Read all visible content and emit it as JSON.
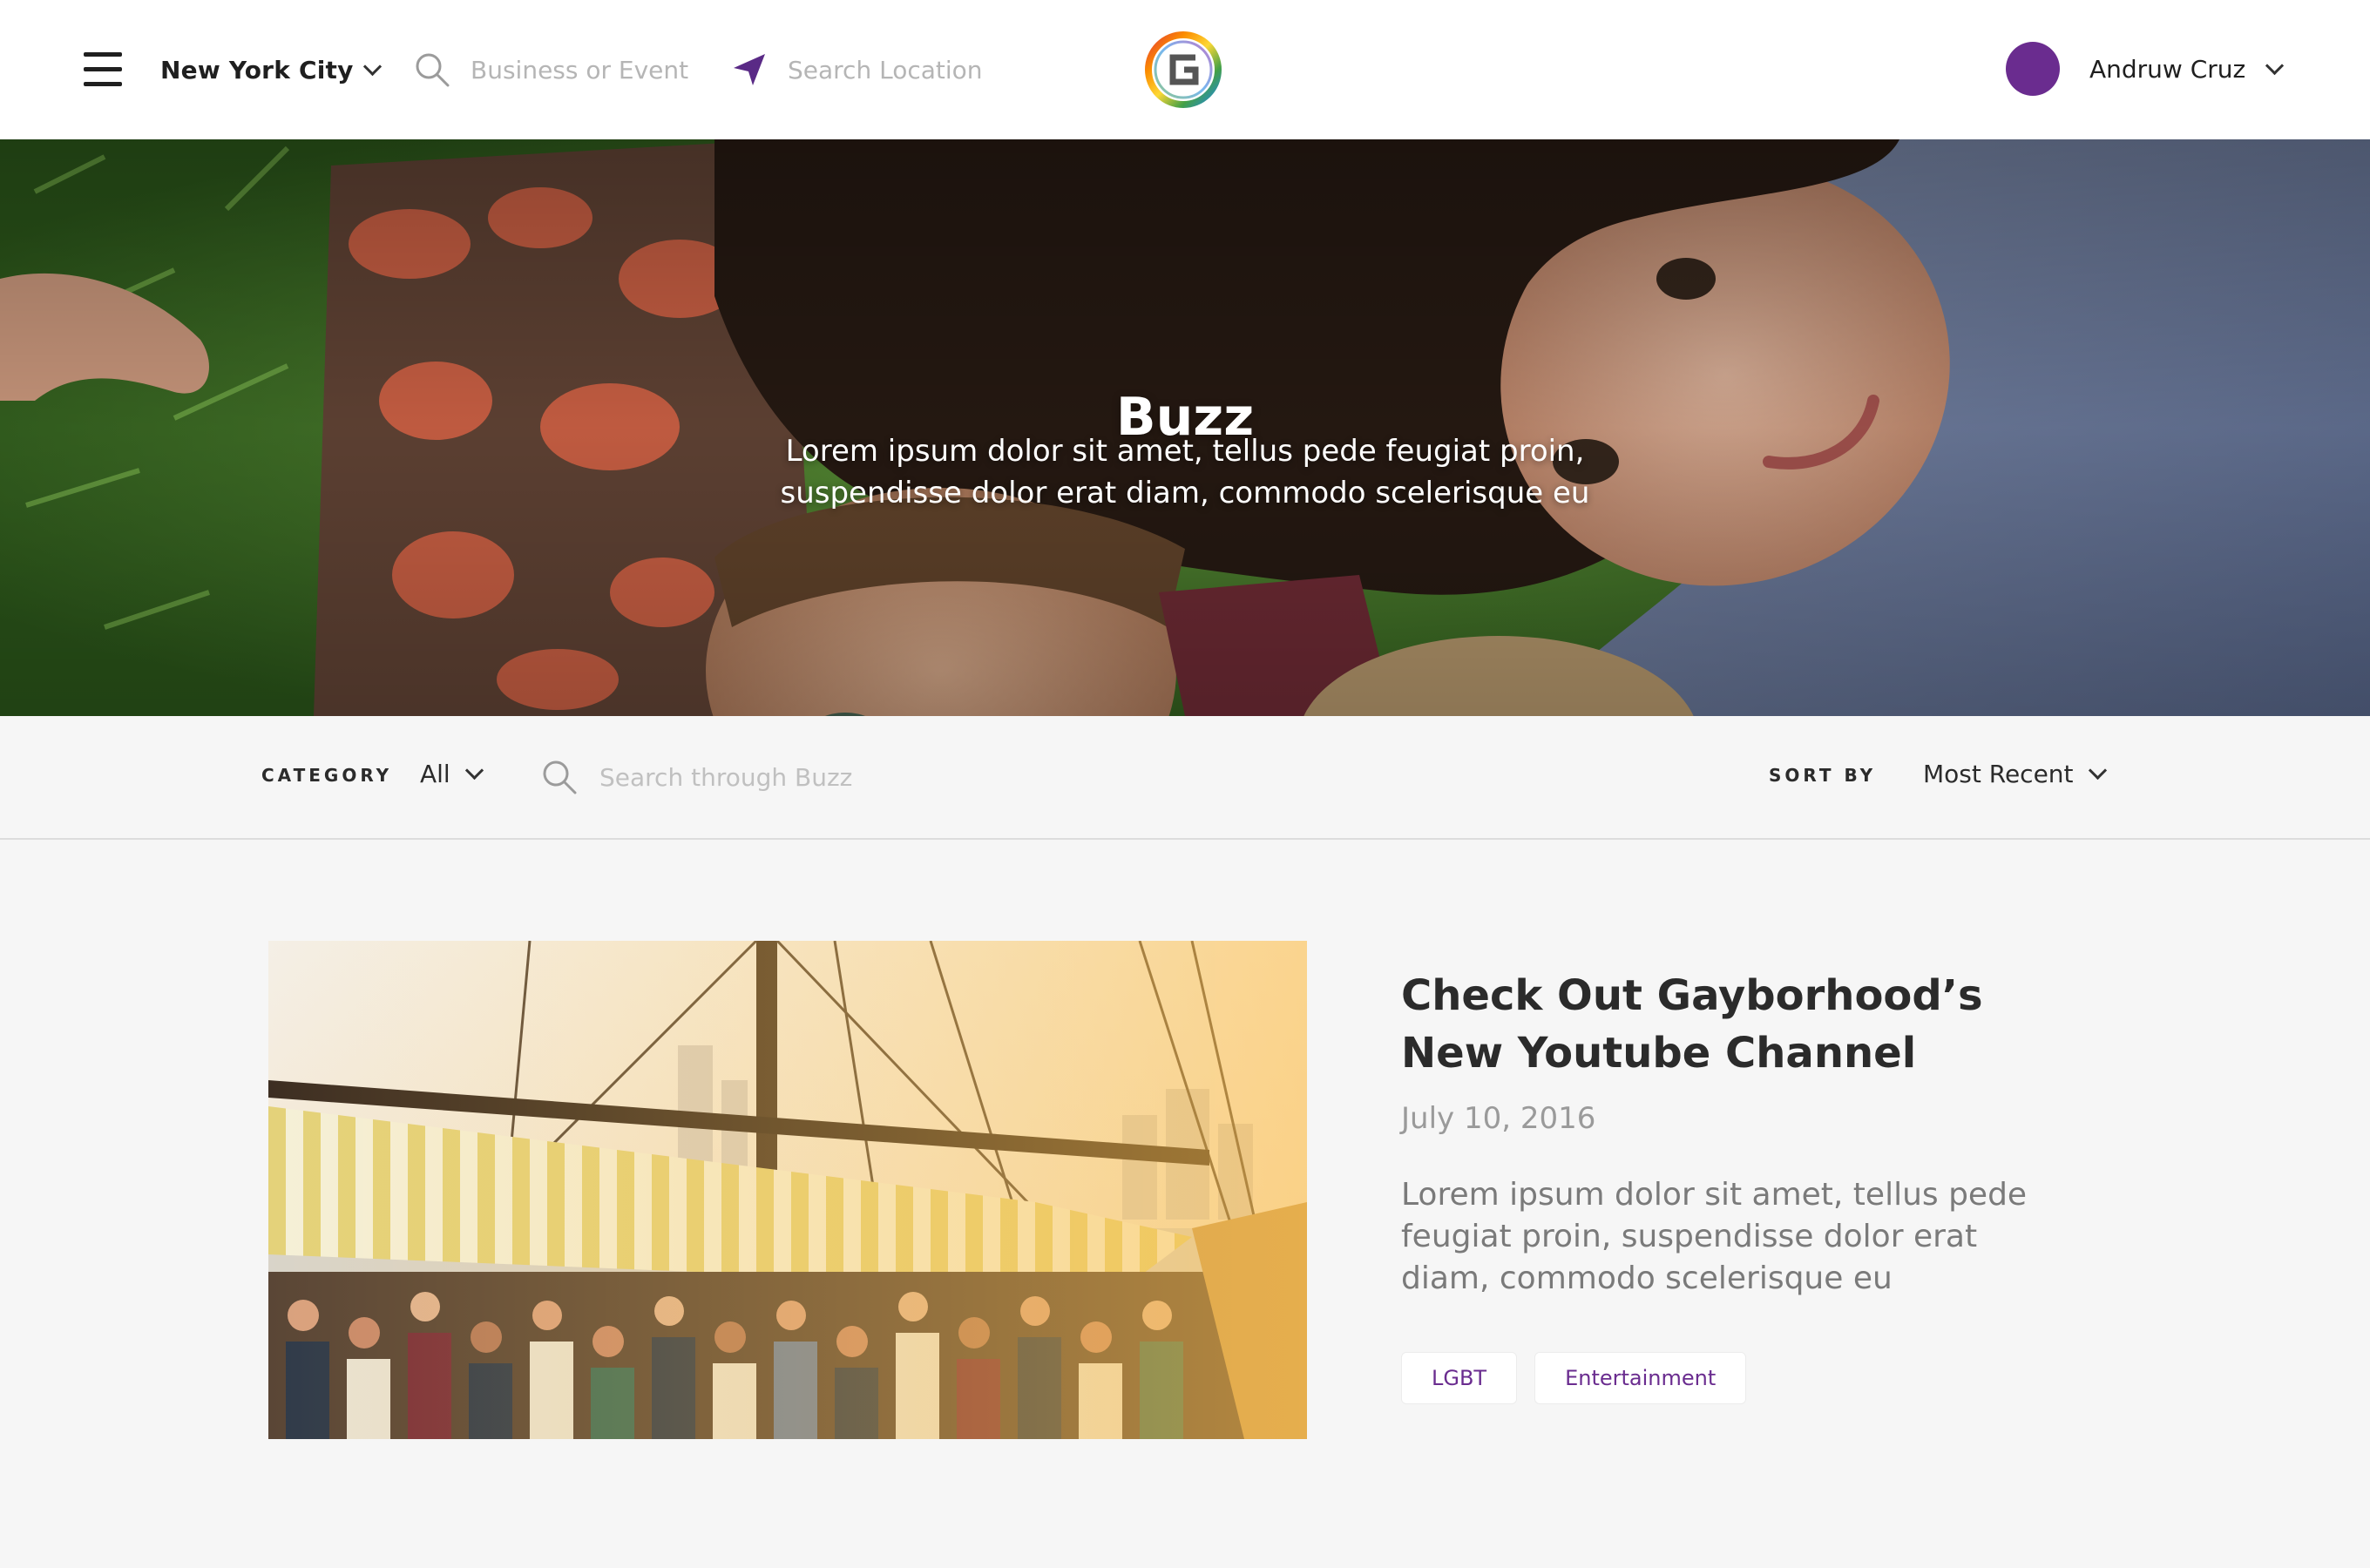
{
  "header": {
    "city": "New York City",
    "business_placeholder": "Business or Event",
    "location_placeholder": "Search Location",
    "user_name": "Andruw Cruz",
    "avatar_color": "#6a2c8f"
  },
  "hero": {
    "title": "Buzz",
    "subtitle": "Lorem ipsum dolor sit amet, tellus pede feugiat proin, suspendisse dolor erat diam, commodo scelerisque eu"
  },
  "filters": {
    "category_label": "CATEGORY",
    "category_value": "All",
    "search_placeholder": "Search through Buzz",
    "sort_label": "SORT BY",
    "sort_value": "Most Recent"
  },
  "articles": [
    {
      "title": "Check Out Gayborhood’s New Youtube Channel",
      "date": "July 10, 2016",
      "excerpt": "Lorem ipsum dolor sit amet, tellus pede feugiat proin, suspendisse dolor erat diam, commodo scelerisque eu",
      "tags": [
        "LGBT",
        "Entertainment"
      ]
    }
  ],
  "colors": {
    "accent": "#6a2c8f",
    "page_background": "#f6f6f6"
  }
}
